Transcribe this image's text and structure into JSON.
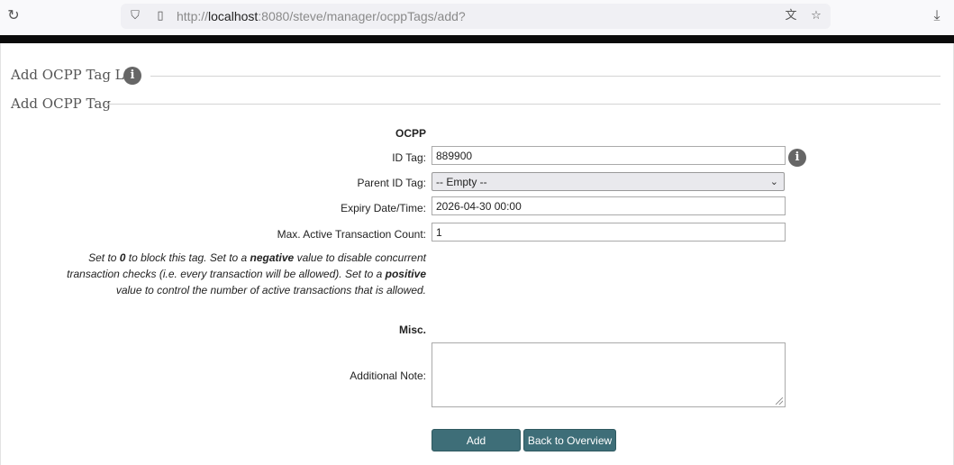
{
  "browser": {
    "url_prefix": "http://",
    "url_host": "localhost",
    "url_path": ":8080/steve/manager/ocppTags/add?"
  },
  "page": {
    "legend_list": "Add OCPP Tag List",
    "legend_tag": "Add OCPP Tag",
    "section_ocpp": "OCPP",
    "section_misc": "Misc."
  },
  "form": {
    "id_tag_label": "ID Tag:",
    "id_tag_value": "889900",
    "parent_id_label": "Parent ID Tag:",
    "parent_id_value": "-- Empty --",
    "expiry_label": "Expiry Date/Time:",
    "expiry_value": "2026-04-30 00:00",
    "max_tx_label": "Max. Active Transaction Count:",
    "max_tx_value": "1",
    "note_label": "Additional Note:",
    "note_value": ""
  },
  "hint": {
    "t1": "Set to ",
    "b1": "0",
    "t2": " to block this tag. Set to a ",
    "b2": "negative",
    "t3": " value to disable concurrent transaction checks (i.e. every transaction will be allowed). Set to a ",
    "b3": "positive",
    "t4": " value to control the number of active transactions that is allowed."
  },
  "buttons": {
    "add": "Add",
    "back": "Back to Overview"
  },
  "colors": {
    "button_bg": "#3e6e78",
    "info_icon": "#666666"
  }
}
